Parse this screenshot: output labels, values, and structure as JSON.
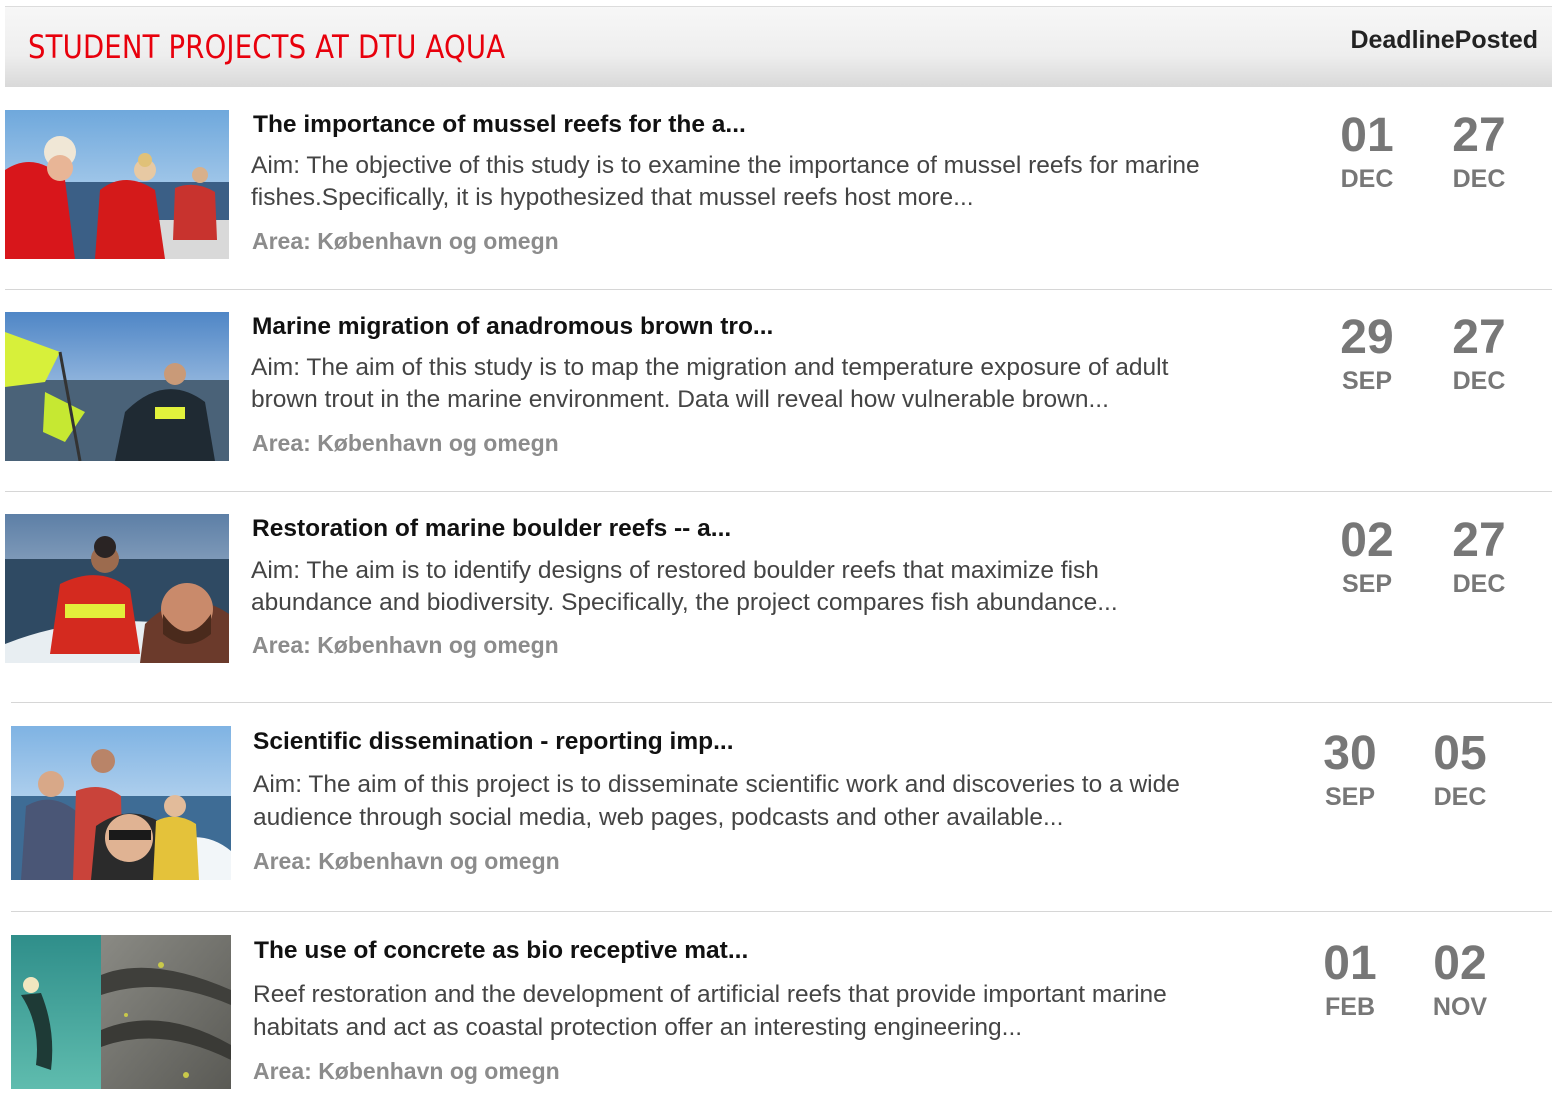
{
  "header": {
    "title": "STUDENT PROJECTS AT DTU AQUA",
    "col_deadline": "Deadline",
    "col_posted": "Posted"
  },
  "projects": [
    {
      "title": "The importance of mussel reefs for the a...",
      "desc_line1": "Aim: The objective of this study is to examine the importance of mussel reefs for marine",
      "desc_line2": "fishes.Specifically, it is hypothesized that mussel reefs host more...",
      "area": "Area: København og omegn",
      "deadline_day": "01",
      "deadline_month": "DEC",
      "posted_day": "27",
      "posted_month": "DEC"
    },
    {
      "title": "Marine migration of anadromous brown tro...",
      "desc_line1": "Aim: The aim of this study is to map the migration and temperature exposure of adult",
      "desc_line2": "brown trout in the marine environment. Data will reveal how vulnerable brown...",
      "area": "Area: København og omegn",
      "deadline_day": "29",
      "deadline_month": "SEP",
      "posted_day": "27",
      "posted_month": "DEC"
    },
    {
      "title": "Restoration of marine boulder reefs -- a...",
      "desc_line1": "Aim: The aim is to identify designs of restored boulder reefs that maximize fish",
      "desc_line2": "abundance and biodiversity. Specifically, the project compares fish abundance...",
      "area": "Area: København og omegn",
      "deadline_day": "02",
      "deadline_month": "SEP",
      "posted_day": "27",
      "posted_month": "DEC"
    },
    {
      "title": "Scientific dissemination - reporting imp...",
      "desc_line1": "Aim: The aim of this project is to disseminate scientific work and discoveries to a wide",
      "desc_line2": "audience through social media, web pages, podcasts and other available...",
      "area": "Area: København og omegn",
      "deadline_day": "30",
      "deadline_month": "SEP",
      "posted_day": "05",
      "posted_month": "DEC"
    },
    {
      "title": "The use of concrete as bio receptive mat...",
      "desc_line1": "Reef restoration and the development of artificial reefs that provide important marine",
      "desc_line2": "habitats and act as coastal protection offer an interesting engineering...",
      "area": "Area: København og omegn",
      "deadline_day": "01",
      "deadline_month": "FEB",
      "posted_day": "02",
      "posted_month": "NOV"
    }
  ]
}
